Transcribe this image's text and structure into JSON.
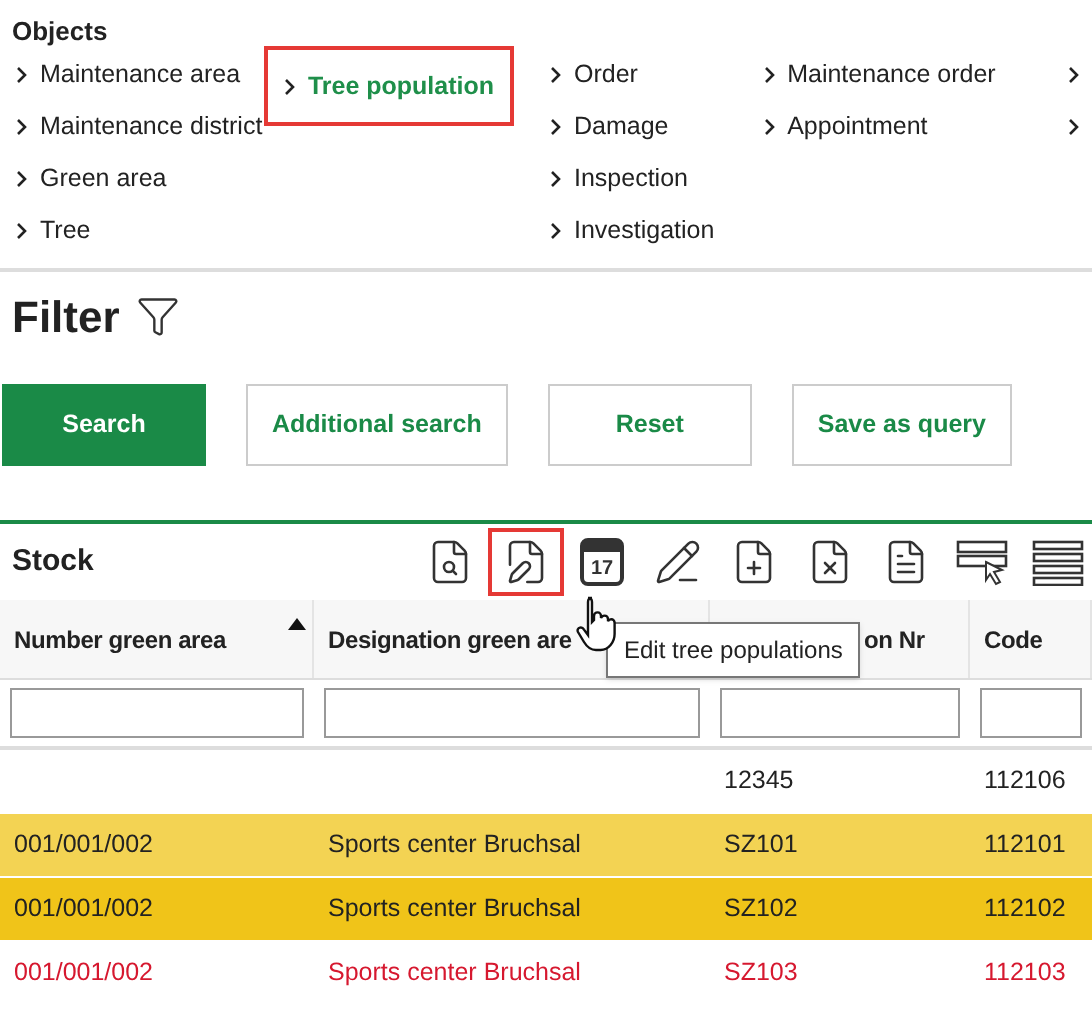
{
  "objects": {
    "title": "Objects",
    "columns": [
      {
        "items": [
          {
            "label": "Maintenance area",
            "selected": false
          },
          {
            "label": "Maintenance district",
            "selected": false
          },
          {
            "label": "Green area",
            "selected": false
          },
          {
            "label": "Tree",
            "selected": false
          }
        ]
      },
      {
        "items": [
          {
            "label": "Tree population",
            "selected": true
          }
        ]
      },
      {
        "items": [
          {
            "label": "Order",
            "selected": false
          },
          {
            "label": "Damage",
            "selected": false
          },
          {
            "label": "Inspection",
            "selected": false
          },
          {
            "label": "Investigation",
            "selected": false
          }
        ]
      },
      {
        "items": [
          {
            "label": "Maintenance order",
            "selected": false
          },
          {
            "label": "Appointment",
            "selected": false
          }
        ]
      },
      {
        "items": [
          {
            "cut_off": true
          },
          {
            "cut_off": true
          }
        ]
      }
    ]
  },
  "filter": {
    "title": "Filter",
    "buttons": [
      {
        "label": "Search",
        "primary": true
      },
      {
        "label": "Additional search",
        "primary": false
      },
      {
        "label": "Reset",
        "primary": false
      },
      {
        "label": "Save as query",
        "primary": false
      }
    ]
  },
  "stock": {
    "title": "Stock",
    "toolbar": [
      {
        "kind": "view",
        "highlighted": false
      },
      {
        "kind": "edit",
        "highlighted": true
      },
      {
        "kind": "calendar",
        "label": "17",
        "highlighted": false
      },
      {
        "kind": "pen-add",
        "highlighted": false
      },
      {
        "kind": "add",
        "highlighted": false
      },
      {
        "kind": "delete",
        "highlighted": false
      },
      {
        "kind": "text",
        "highlighted": false
      },
      {
        "kind": "select-row",
        "highlighted": false
      },
      {
        "kind": "rows",
        "highlighted": false
      }
    ],
    "tooltip": "Edit tree populations",
    "columns": [
      {
        "label": "Number green area",
        "sorted": true
      },
      {
        "label": "Designation green are",
        "sorted": false
      },
      {
        "label": "on Nr",
        "sorted": false
      },
      {
        "label": "Code",
        "sorted": false
      }
    ],
    "rows": [
      {
        "kind": "plain",
        "cells": [
          null,
          null,
          "12345",
          "112106"
        ]
      },
      {
        "kind": "marked",
        "cells": [
          "001/001/002",
          "Sports center Bruchsal",
          "SZ101",
          "112101"
        ]
      },
      {
        "kind": "selected",
        "cells": [
          "001/001/002",
          "Sports center Bruchsal",
          "SZ102",
          "112102"
        ]
      },
      {
        "kind": "alert",
        "cells": [
          "001/001/002",
          "Sports center Bruchsal",
          "SZ103",
          "112103"
        ]
      }
    ]
  }
}
